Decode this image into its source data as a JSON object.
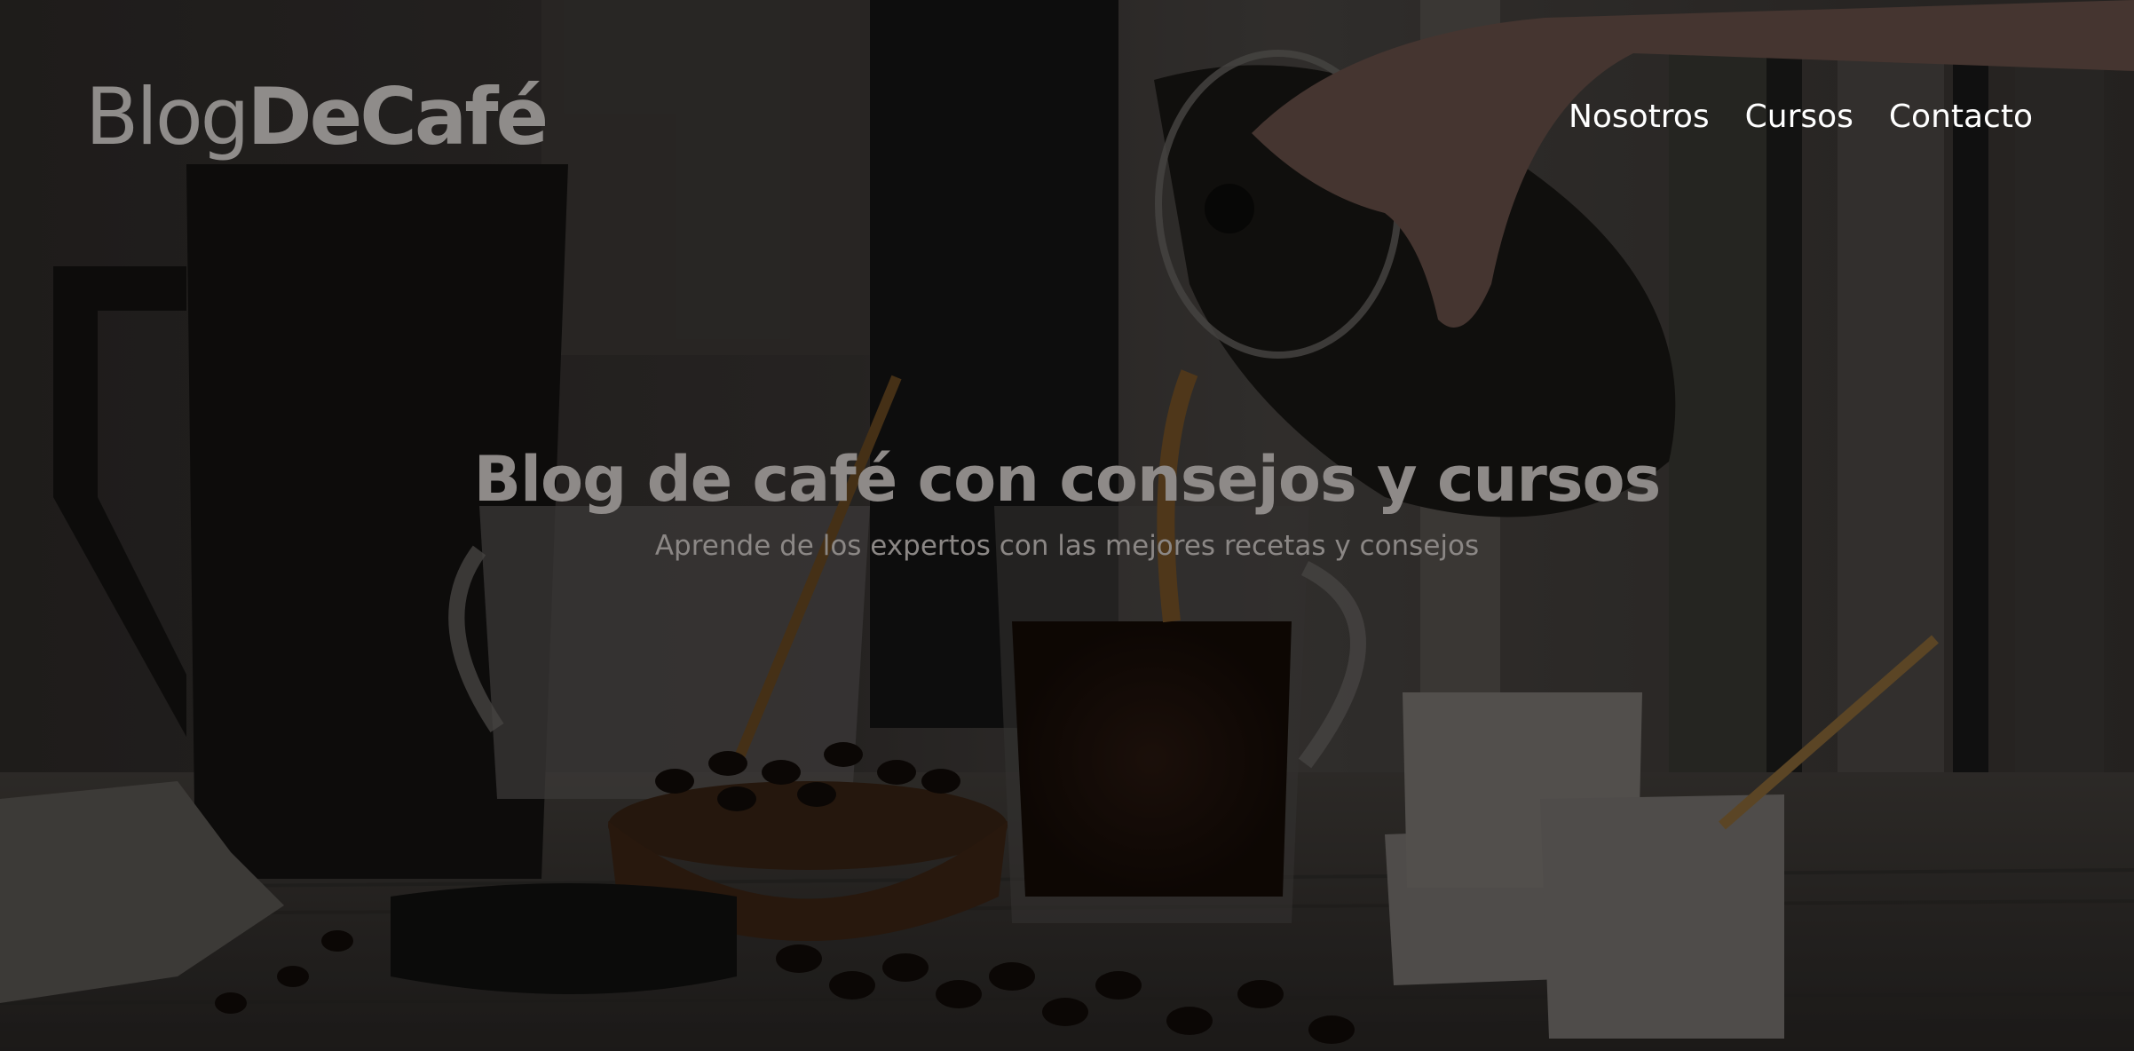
{
  "header": {
    "logo_light": "Blog",
    "logo_bold": "DeCafé",
    "nav": [
      {
        "label": "Nosotros"
      },
      {
        "label": "Cursos"
      },
      {
        "label": "Contacto"
      }
    ]
  },
  "hero": {
    "title": "Blog de café con consejos y cursos",
    "subtitle": "Aprende de los expertos con las mejores recetas y consejos",
    "background": "coffee-pouring-photo"
  },
  "colors": {
    "overlay": "#000000",
    "text_muted": "#8e8a88",
    "nav_text": "#ffffff"
  }
}
